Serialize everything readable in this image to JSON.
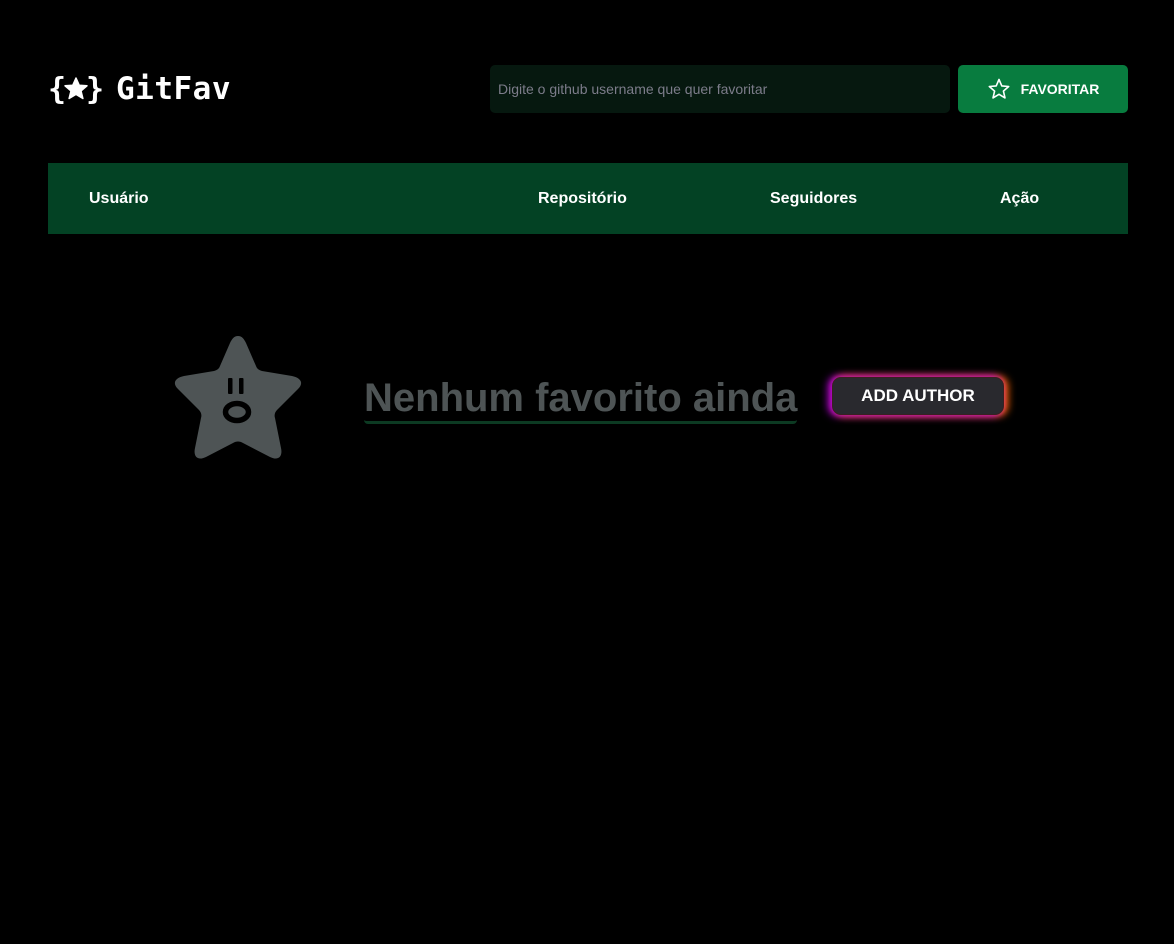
{
  "app": {
    "name": "GitFav",
    "logo_icon": "star-braces-icon"
  },
  "search": {
    "placeholder": "Digite o github username que quer favoritar",
    "value": ""
  },
  "favorite_button": {
    "label": "FAVORITAR",
    "icon": "star-outline-icon"
  },
  "table": {
    "columns": [
      "Usuário",
      "Repositório",
      "Seguidores",
      "Ação"
    ]
  },
  "empty_state": {
    "icon": "surprised-star-icon",
    "message": "Nenhum favorito ainda",
    "add_button_label": "ADD AUTHOR"
  },
  "colors": {
    "background": "#000000",
    "accent": "#087c3f",
    "table_header": "#034224",
    "input_background": "#06180f",
    "empty_text": "#4e5455"
  }
}
